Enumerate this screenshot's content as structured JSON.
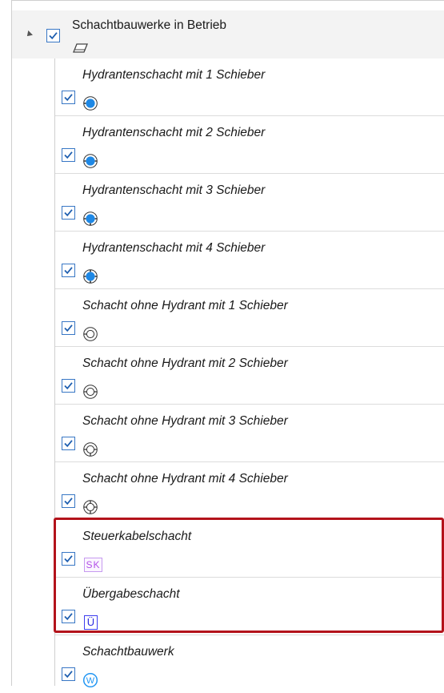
{
  "layer_tree": {
    "group": {
      "label": "Schachtbauwerke in Betrieb",
      "checked": true,
      "icon": "eraser-icon"
    },
    "items": [
      {
        "label": "Hydrantenschacht mit 1 Schieber",
        "checked": true,
        "icon": "hydrant-valve-1-icon"
      },
      {
        "label": "Hydrantenschacht mit 2 Schieber",
        "checked": true,
        "icon": "hydrant-valve-2-icon"
      },
      {
        "label": "Hydrantenschacht mit 3 Schieber",
        "checked": true,
        "icon": "hydrant-valve-3-icon"
      },
      {
        "label": "Hydrantenschacht mit 4 Schieber",
        "checked": true,
        "icon": "hydrant-valve-4-icon"
      },
      {
        "label": "Schacht ohne Hydrant mit 1 Schieber",
        "checked": true,
        "icon": "shaft-valve-1-icon"
      },
      {
        "label": "Schacht ohne Hydrant mit 2 Schieber",
        "checked": true,
        "icon": "shaft-valve-2-icon"
      },
      {
        "label": "Schacht ohne Hydrant mit 3 Schieber",
        "checked": true,
        "icon": "shaft-valve-3-icon"
      },
      {
        "label": "Schacht ohne Hydrant mit 4 Schieber",
        "checked": true,
        "icon": "shaft-valve-4-icon"
      },
      {
        "label": "Steuerkabelschacht",
        "checked": true,
        "icon": "sk-badge-icon",
        "badge": "SK"
      },
      {
        "label": "Übergabeschacht",
        "checked": true,
        "icon": "ue-badge-icon",
        "badge": "Ü"
      },
      {
        "label": "Schachtbauwerk",
        "checked": true,
        "icon": "w-circle-icon",
        "badge": "W"
      }
    ]
  },
  "colors": {
    "checkbox_border": "#3877c5",
    "checkmark": "#1f5fb0",
    "hydrant_fill": "#1e88e5",
    "highlight_border": "#b3131b",
    "sk_color": "#b24fe8",
    "ue_color": "#2a2ae0",
    "w_color": "#2196f3"
  }
}
